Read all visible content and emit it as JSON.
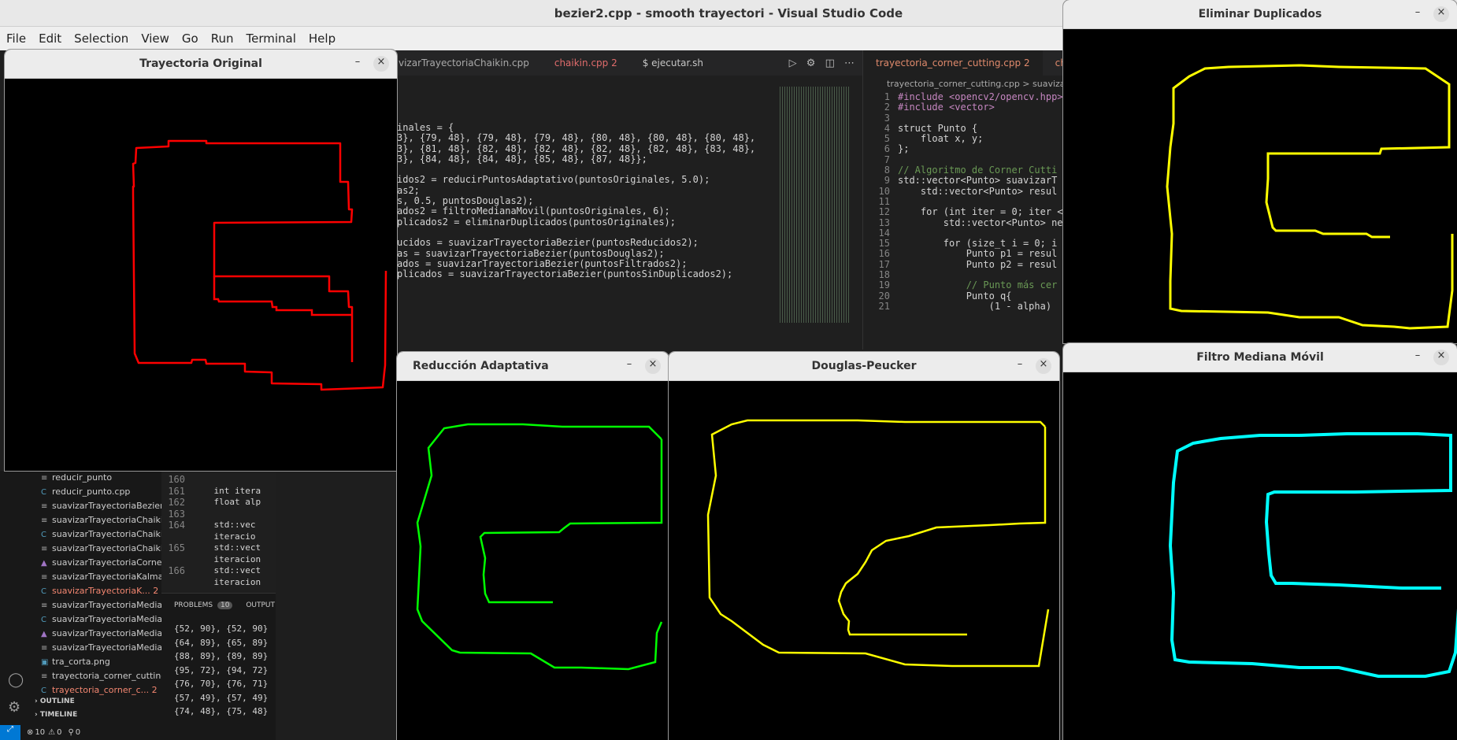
{
  "window_title": "bezier2.cpp - smooth trayectori - Visual Studio Code",
  "menu": [
    "File",
    "Edit",
    "Selection",
    "View",
    "Go",
    "Run",
    "Terminal",
    "Help"
  ],
  "center_tabs": [
    {
      "label": "vizarTrayectoriaChaikin.cpp",
      "active": false
    },
    {
      "label": "chaikin.cpp  2",
      "active": false
    },
    {
      "label": "$  ejecutar.sh",
      "active": false
    }
  ],
  "center_code": [
    "inales = {",
    "3}, {79, 48}, {79, 48}, {79, 48}, {80, 48}, {80, 48}, {80, 48},",
    "3}, {81, 48}, {82, 48}, {82, 48}, {82, 48}, {82, 48}, {83, 48},",
    "3}, {84, 48}, {84, 48}, {85, 48}, {87, 48}};",
    "",
    "idos2 = reducirPuntosAdaptativo(puntosOriginales, 5.0);",
    "as2;",
    "s, 0.5, puntosDouglas2);",
    "ados2 = filtroMedianaMovil(puntosOriginales, 6);",
    "plicados2 = eliminarDuplicados(puntosOriginales);",
    "",
    "ucidos = suavizarTrayectoriaBezier(puntosReducidos2);",
    "as = suavizarTrayectoriaBezier(puntosDouglas2);",
    "ados = suavizarTrayectoriaBezier(puntosFiltrados2);",
    "plicados = suavizarTrayectoriaBezier(puntosSinDuplicados2);"
  ],
  "right_tabs": [
    {
      "label": "trayectoria_corner_cutting.cpp  2",
      "active": true
    },
    {
      "label": "cha",
      "active": false
    }
  ],
  "right_breadcrumb": "trayectoria_corner_cutting.cpp  >  suavizarT",
  "right_code": [
    {
      "n": "1",
      "t": "#include <opencv2/opencv.hpp>"
    },
    {
      "n": "2",
      "t": "#include <vector>"
    },
    {
      "n": "3",
      "t": ""
    },
    {
      "n": "4",
      "t": "struct Punto {"
    },
    {
      "n": "5",
      "t": "    float x, y;"
    },
    {
      "n": "6",
      "t": "};"
    },
    {
      "n": "7",
      "t": ""
    },
    {
      "n": "8",
      "t": "// Algoritmo de Corner Cutti"
    },
    {
      "n": "9",
      "t": "std::vector<Punto> suavizarT"
    },
    {
      "n": "10",
      "t": "    std::vector<Punto> resul"
    },
    {
      "n": "11",
      "t": ""
    },
    {
      "n": "12",
      "t": "    for (int iter = 0; iter <"
    },
    {
      "n": "13",
      "t": "        std::vector<Punto> ne"
    },
    {
      "n": "14",
      "t": ""
    },
    {
      "n": "15",
      "t": "        for (size_t i = 0; i"
    },
    {
      "n": "16",
      "t": "            Punto p1 = resul"
    },
    {
      "n": "17",
      "t": "            Punto p2 = resul"
    },
    {
      "n": "18",
      "t": ""
    },
    {
      "n": "19",
      "t": "            // Punto más cer"
    },
    {
      "n": "20",
      "t": "            Punto q{"
    },
    {
      "n": "21",
      "t": "                (1 - alpha)"
    }
  ],
  "sidebar_files": [
    {
      "label": "reducir_punto",
      "icon": "list-icon",
      "error": false
    },
    {
      "label": "reducir_punto.cpp",
      "icon": "cpp-icon",
      "error": false
    },
    {
      "label": "suavizarTrayectoriaBezier",
      "icon": "list-icon",
      "error": false
    },
    {
      "label": "suavizarTrayectoriaChaikin",
      "icon": "list-icon",
      "error": false
    },
    {
      "label": "suavizarTrayectoriaChaiki...",
      "icon": "cpp-icon",
      "error": false
    },
    {
      "label": "suavizarTrayectoriaChaiki...",
      "icon": "list-icon",
      "error": false
    },
    {
      "label": "suavizarTrayectoriaCorne...",
      "icon": "cmake-icon",
      "error": false
    },
    {
      "label": "suavizarTrayectoriaKalman",
      "icon": "list-icon",
      "error": false
    },
    {
      "label": "suavizarTrayectoriaK...  2",
      "icon": "cpp-icon",
      "error": true
    },
    {
      "label": "suavizarTrayectoriaMedia...",
      "icon": "list-icon",
      "error": false
    },
    {
      "label": "suavizarTrayectoriaMedia...",
      "icon": "cpp-icon",
      "error": false
    },
    {
      "label": "suavizarTrayectoriaMedia...",
      "icon": "cmake-icon",
      "error": false
    },
    {
      "label": "suavizarTrayectoriaMedia...",
      "icon": "list-icon",
      "error": false
    },
    {
      "label": "tra_corta.png",
      "icon": "image-icon",
      "error": false
    },
    {
      "label": "trayectoria_corner_cutting",
      "icon": "list-icon",
      "error": false
    },
    {
      "label": "trayectoria_corner_c...  2",
      "icon": "cpp-icon",
      "error": true
    }
  ],
  "outline_label": "OUTLINE",
  "timeline_label": "TIMELINE",
  "lower_code": [
    {
      "n": "160",
      "t": ""
    },
    {
      "n": "161",
      "t": "    int itera"
    },
    {
      "n": "162",
      "t": "    float alp"
    },
    {
      "n": "163",
      "t": ""
    },
    {
      "n": "164",
      "t": "    std::vec"
    },
    {
      "n": "",
      "t": "    iteracio"
    },
    {
      "n": "165",
      "t": "    std::vect"
    },
    {
      "n": "",
      "t": "    iteracion"
    },
    {
      "n": "166",
      "t": "    std::vect"
    },
    {
      "n": "",
      "t": "    iteracion"
    }
  ],
  "panel": {
    "problems": "PROBLEMS",
    "problems_count": "10",
    "output": "OUTPUT"
  },
  "terminal_lines": [
    "{52, 90}, {52, 90}",
    "{64, 89}, {65, 89}",
    "{88, 89}, {89, 89}",
    "{95, 72}, {94, 72}",
    "{76, 70}, {76, 71}",
    "{57, 49}, {57, 49}",
    "{74, 48}, {75, 48}"
  ],
  "status": {
    "errors": "10",
    "warnings": "0",
    "ports": "0"
  },
  "windows": {
    "original": {
      "title": "Trayectoria Original",
      "color": "#ff0000"
    },
    "reduccion": {
      "title": "Reducción Adaptativa",
      "color": "#00ff00"
    },
    "douglas": {
      "title": "Douglas-Peucker",
      "color": "#ffff00"
    },
    "duplicados": {
      "title": "Eliminar Duplicados",
      "color": "#ffff00"
    },
    "mediana": {
      "title": "Filtro Mediana Móvil",
      "color": "#00ffff"
    }
  },
  "icons": {
    "minimize": "–",
    "close": "×"
  }
}
